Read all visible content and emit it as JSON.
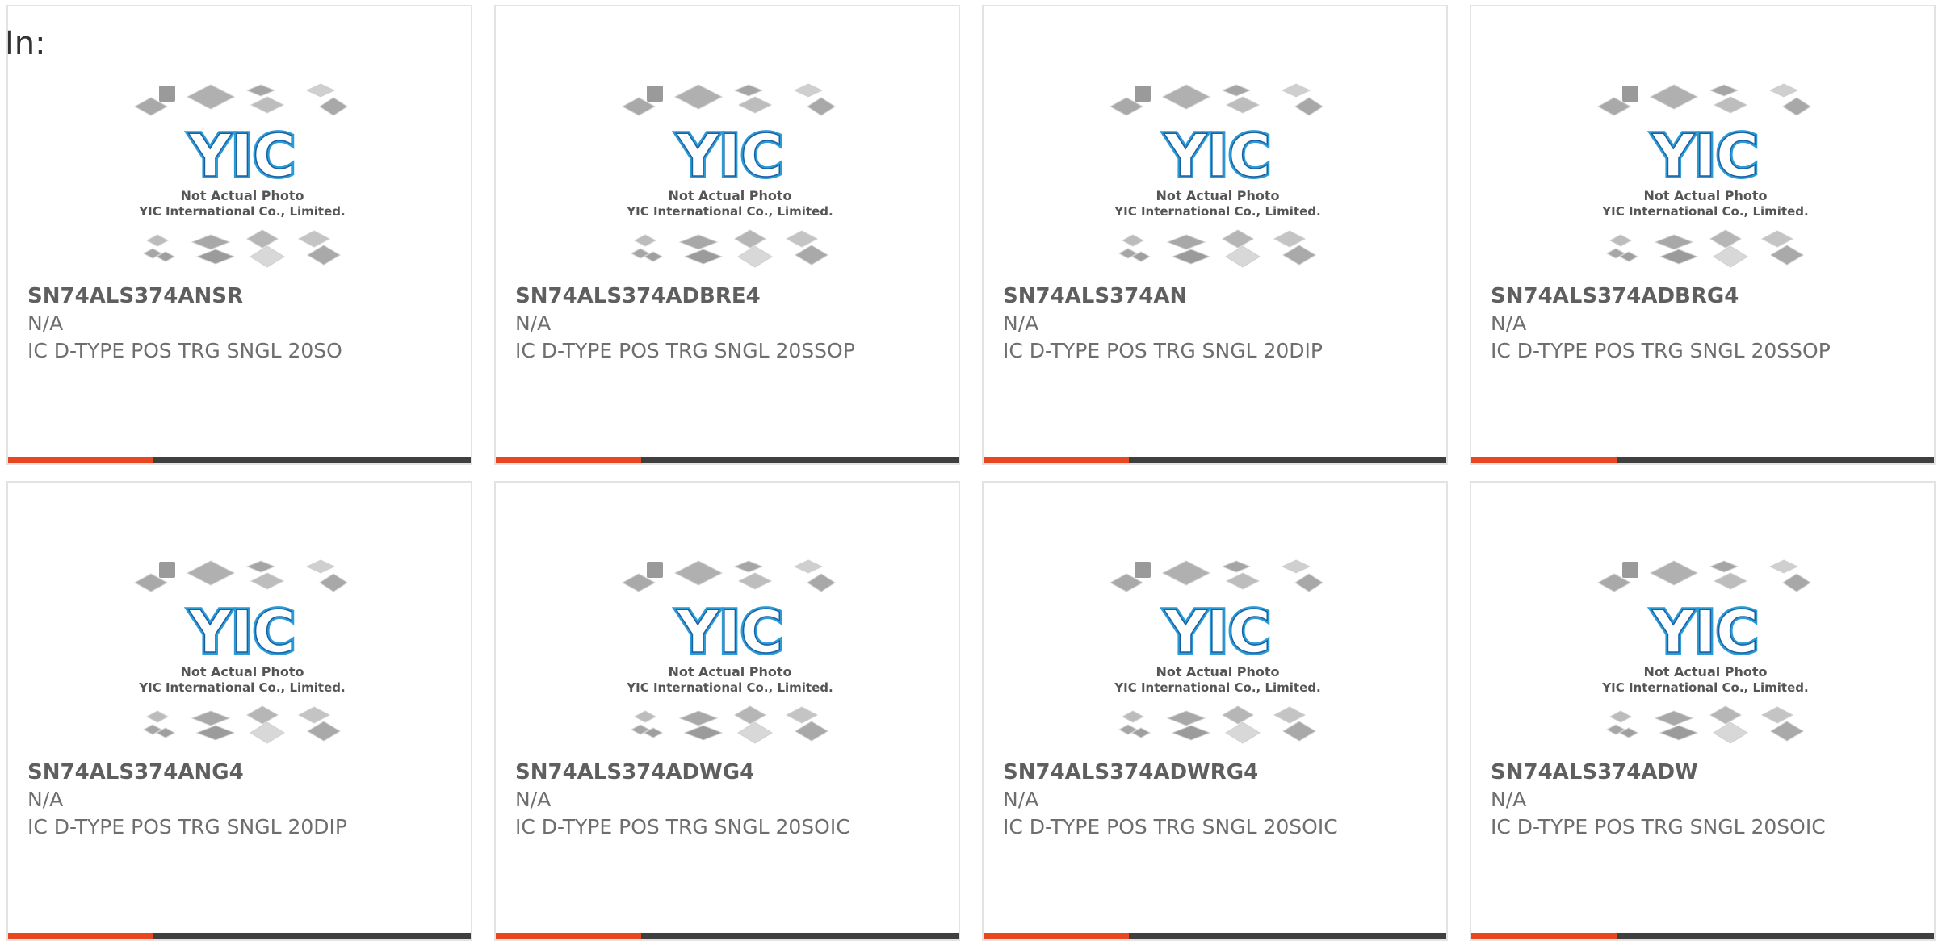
{
  "page": {
    "label": "In:"
  },
  "photo": {
    "caption_line1": "Not Actual Photo",
    "caption_line2": "YIC International Co., Limited.",
    "logo_text": "YIC"
  },
  "colors": {
    "accent": "#e8461e",
    "bar": "#3f3f3f",
    "logo_blue": "#2b9bd6",
    "logo_dark": "#1b5fa3"
  },
  "products": [
    {
      "part_number": "SN74ALS374ANSR",
      "manufacturer": "N/A",
      "description": "IC D-TYPE POS TRG SNGL 20SO"
    },
    {
      "part_number": "SN74ALS374ADBRE4",
      "manufacturer": "N/A",
      "description": "IC D-TYPE POS TRG SNGL 20SSOP"
    },
    {
      "part_number": "SN74ALS374AN",
      "manufacturer": "N/A",
      "description": "IC D-TYPE POS TRG SNGL 20DIP"
    },
    {
      "part_number": "SN74ALS374ADBRG4",
      "manufacturer": "N/A",
      "description": "IC D-TYPE POS TRG SNGL 20SSOP"
    },
    {
      "part_number": "SN74ALS374ANG4",
      "manufacturer": "N/A",
      "description": "IC D-TYPE POS TRG SNGL 20DIP"
    },
    {
      "part_number": "SN74ALS374ADWG4",
      "manufacturer": "N/A",
      "description": "IC D-TYPE POS TRG SNGL 20SOIC"
    },
    {
      "part_number": "SN74ALS374ADWRG4",
      "manufacturer": "N/A",
      "description": "IC D-TYPE POS TRG SNGL 20SOIC"
    },
    {
      "part_number": "SN74ALS374ADW",
      "manufacturer": "N/A",
      "description": "IC D-TYPE POS TRG SNGL 20SOIC"
    }
  ]
}
